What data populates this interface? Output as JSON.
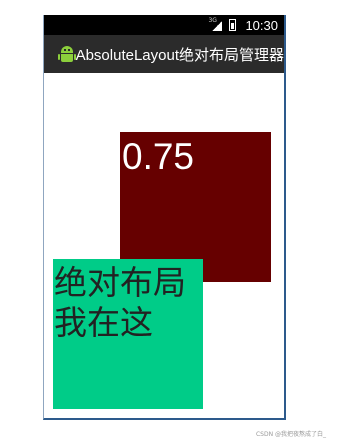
{
  "status_bar": {
    "network_tag": "3G",
    "time": "10:30"
  },
  "action_bar": {
    "app_icon": "android-icon",
    "title": "AbsoluteLayout绝对布局管理器"
  },
  "content": {
    "red_box": {
      "text": "0.75",
      "color": "#660000"
    },
    "green_box": {
      "text": "绝对布局我在这",
      "color": "#00cc88"
    }
  },
  "watermark": "CSDN @我把夜熬成了白_"
}
